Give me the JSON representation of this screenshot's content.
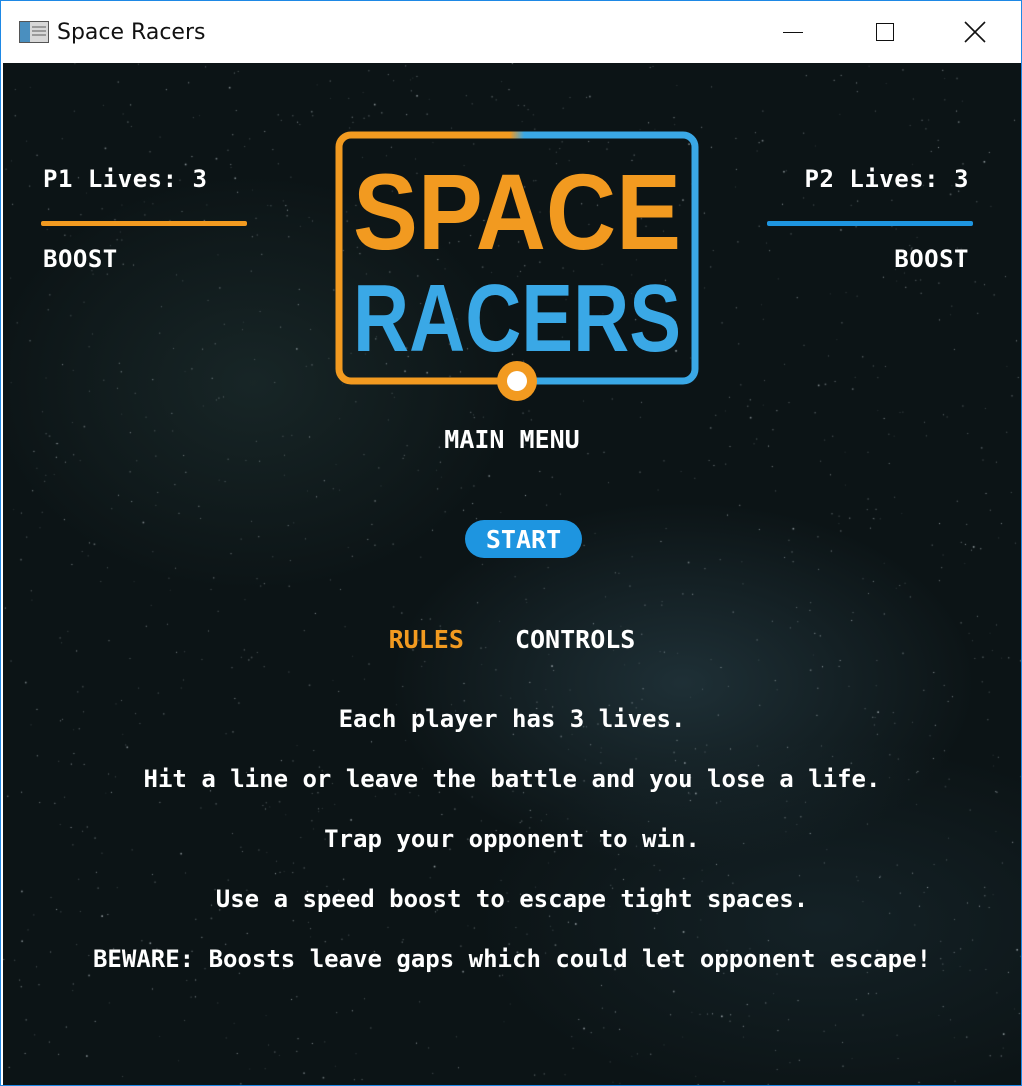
{
  "window": {
    "title": "Space Racers"
  },
  "hud": {
    "p1": {
      "lives_label": "P1 Lives: 3",
      "boost_label": "BOOST",
      "color": "#f29a20",
      "boost_level": 1.0
    },
    "p2": {
      "lives_label": "P2 Lives: 3",
      "boost_label": "BOOST",
      "color": "#1e95e0",
      "boost_level": 1.0
    }
  },
  "logo": {
    "line1": "SPACE",
    "line2": "RACERS",
    "orange": "#f29a20",
    "blue": "#3aa8e6"
  },
  "menu": {
    "title": "MAIN MENU",
    "start_label": "START",
    "start_color": "#1e95e0"
  },
  "tabs": [
    {
      "label": "RULES",
      "active": true,
      "color": "#f29a20"
    },
    {
      "label": "CONTROLS",
      "active": false,
      "color": "#ffffff"
    }
  ],
  "rules": [
    "Each player has 3 lives.",
    "Hit a line or leave the battle and you lose a life.",
    "Trap your opponent to win.",
    "Use a speed boost to escape tight spaces.",
    "BEWARE: Boosts leave gaps which could let opponent escape!"
  ]
}
